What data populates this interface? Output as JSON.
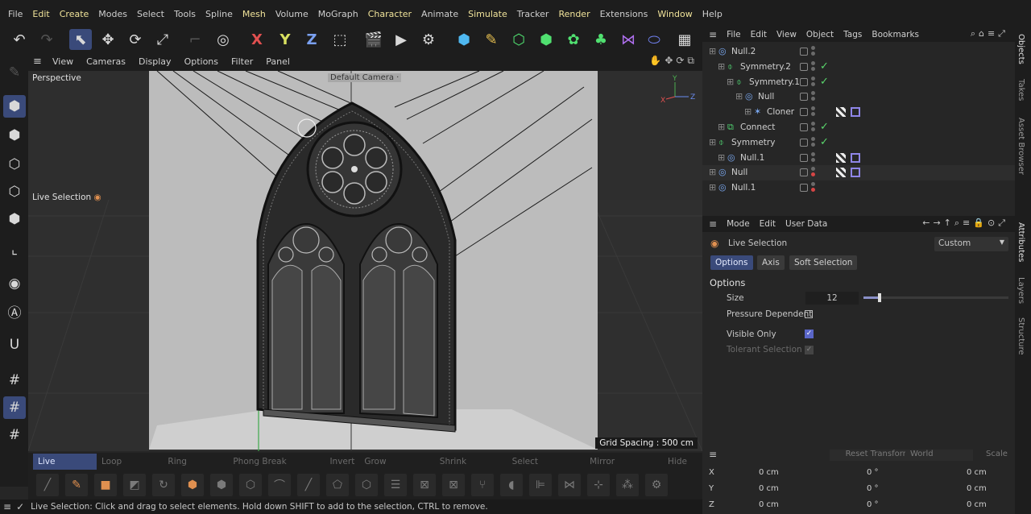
{
  "menubar": {
    "items": [
      {
        "label": "File",
        "hl": false
      },
      {
        "label": "Edit",
        "hl": true
      },
      {
        "label": "Create",
        "hl": true
      },
      {
        "label": "Modes",
        "hl": false
      },
      {
        "label": "Select",
        "hl": false
      },
      {
        "label": "Tools",
        "hl": false
      },
      {
        "label": "Spline",
        "hl": false
      },
      {
        "label": "Mesh",
        "hl": true
      },
      {
        "label": "Volume",
        "hl": false
      },
      {
        "label": "MoGraph",
        "hl": false
      },
      {
        "label": "Character",
        "hl": true
      },
      {
        "label": "Animate",
        "hl": false
      },
      {
        "label": "Simulate",
        "hl": true
      },
      {
        "label": "Tracker",
        "hl": false
      },
      {
        "label": "Render",
        "hl": true
      },
      {
        "label": "Extensions",
        "hl": false
      },
      {
        "label": "Window",
        "hl": true
      },
      {
        "label": "Help",
        "hl": false
      }
    ]
  },
  "toolbar": {
    "x_label": "X",
    "y_label": "Y",
    "z_label": "Z"
  },
  "viewport": {
    "menu": [
      "View",
      "Cameras",
      "Display",
      "Options",
      "Filter",
      "Panel"
    ],
    "camera_name": "Perspective",
    "default_camera": "Default Camera",
    "live_selection_label": "Live Selection",
    "grid_spacing": "Grid Spacing : 500 cm",
    "axis_x": "X",
    "axis_y": "Y",
    "axis_z": "Z"
  },
  "modebar": {
    "items": [
      {
        "label": "Live Selection",
        "active": true
      },
      {
        "label": "Loop Selection",
        "active": false
      },
      {
        "label": "Ring Selection",
        "active": false
      },
      {
        "label": "Phong Break Selection",
        "active": false
      },
      {
        "label": "Invert",
        "active": false
      },
      {
        "label": "Grow Selection...",
        "active": false
      },
      {
        "label": "Shrink Selection",
        "active": false
      },
      {
        "label": "Select Connected",
        "active": false
      },
      {
        "label": "Mirror Selection...",
        "active": false
      },
      {
        "label": "Hide Se",
        "active": false
      }
    ]
  },
  "status": {
    "text": "Live Selection: Click and drag to select elements. Hold down SHIFT to add to the selection, CTRL to remove."
  },
  "objects": {
    "menu": [
      "File",
      "Edit",
      "View",
      "Object",
      "Tags",
      "Bookmarks"
    ],
    "rows": [
      {
        "name": "Null.2",
        "indent": 0,
        "dot_red": false,
        "check": false,
        "tags": false
      },
      {
        "name": "Symmetry.2",
        "indent": 1,
        "dot_red": false,
        "check": true,
        "tags": false
      },
      {
        "name": "Symmetry.1",
        "indent": 2,
        "dot_red": false,
        "check": true,
        "tags": false
      },
      {
        "name": "Null",
        "indent": 3,
        "dot_red": false,
        "check": false,
        "tags": false
      },
      {
        "name": "Cloner",
        "indent": 4,
        "dot_red": false,
        "check": false,
        "tags": true
      },
      {
        "name": "Connect",
        "indent": 1,
        "dot_red": false,
        "check": true,
        "tags": false
      },
      {
        "name": "Symmetry",
        "indent": 0,
        "dot_red": false,
        "check": true,
        "tags": false
      },
      {
        "name": "Null.1",
        "indent": 1,
        "dot_red": false,
        "check": false,
        "tags": true
      },
      {
        "name": "Null",
        "indent": 0,
        "dot_red": true,
        "check": false,
        "tags": true
      },
      {
        "name": "Null.1",
        "indent": 0,
        "dot_red": true,
        "check": false,
        "tags": false
      }
    ]
  },
  "sidetabs": [
    "Objects",
    "Takes",
    "Asset Browser",
    "Attributes",
    "Layers",
    "Structure"
  ],
  "attributes": {
    "menu": [
      "Mode",
      "Edit",
      "User Data"
    ],
    "tool_name": "Live Selection",
    "preset": "Custom",
    "tabs": [
      {
        "label": "Options",
        "active": true
      },
      {
        "label": "Axis",
        "active": false
      },
      {
        "label": "Soft Selection",
        "active": false
      }
    ],
    "section": "Options",
    "size_label": "Size",
    "size_value": "12",
    "size_fraction": 0.1,
    "pressure_label": "Pressure Dependent",
    "visible_only_label": "Visible Only",
    "tolerant_label": "Tolerant Selection"
  },
  "coords": {
    "reset": "Reset Transform",
    "space": "World",
    "mode": "Scale",
    "rows": [
      {
        "axis": "X",
        "pos": "0 cm",
        "rot": "0 °",
        "scale": "0 cm"
      },
      {
        "axis": "Y",
        "pos": "0 cm",
        "rot": "0 °",
        "scale": "0 cm"
      },
      {
        "axis": "Z",
        "pos": "0 cm",
        "rot": "0 °",
        "scale": "0 cm"
      }
    ]
  }
}
